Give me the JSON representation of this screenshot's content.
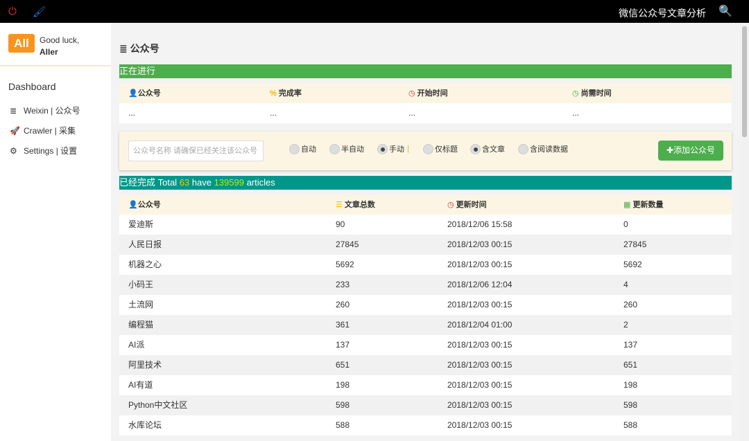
{
  "topbar": {
    "title": "微信公众号文章分析"
  },
  "sidebar": {
    "logo": "All",
    "greeting": "Good luck,",
    "user": "AIIer",
    "section": "Dashboard",
    "items": [
      {
        "icon": "≣",
        "label": "Weixin | 公众号"
      },
      {
        "icon": "🚀",
        "label": "Crawler | 采集"
      },
      {
        "icon": "⚙",
        "label": "Settings | 设置"
      }
    ]
  },
  "main": {
    "title": "公众号",
    "running": {
      "band": "正在进行",
      "headers": [
        "公众号",
        "完成率",
        "开始时间",
        "尚需时间"
      ],
      "row": [
        "...",
        "...",
        "...",
        "..."
      ]
    },
    "form": {
      "placeholder": "公众号名称 请确保已经关注该公众号",
      "radios": [
        "自动",
        "半自动",
        "手动",
        "仅标题",
        "含文章",
        "含阅读数据"
      ],
      "add": "添加公众号"
    },
    "done": {
      "prefix": "已经完成 Total ",
      "total": "63",
      "mid": " have ",
      "articles": "139599",
      "suffix": " articles",
      "headers": [
        "公众号",
        "文章总数",
        "更新时间",
        "更新数量"
      ],
      "rows": [
        [
          "爱迪斯",
          "90",
          "2018/12/06 15:58",
          "0"
        ],
        [
          "人民日报",
          "27845",
          "2018/12/03 00:15",
          "27845"
        ],
        [
          "机器之心",
          "5692",
          "2018/12/03 00:15",
          "5692"
        ],
        [
          "小码王",
          "233",
          "2018/12/06 12:04",
          "4"
        ],
        [
          "土流网",
          "260",
          "2018/12/03 00:15",
          "260"
        ],
        [
          "编程猫",
          "361",
          "2018/12/04 01:00",
          "2"
        ],
        [
          "AI派",
          "137",
          "2018/12/03 00:15",
          "137"
        ],
        [
          "阿里技术",
          "651",
          "2018/12/03 00:15",
          "651"
        ],
        [
          "AI有道",
          "198",
          "2018/12/03 00:15",
          "198"
        ],
        [
          "Python中文社区",
          "598",
          "2018/12/03 00:15",
          "598"
        ],
        [
          "水库论坛",
          "588",
          "2018/12/03 00:15",
          "588"
        ]
      ]
    }
  }
}
